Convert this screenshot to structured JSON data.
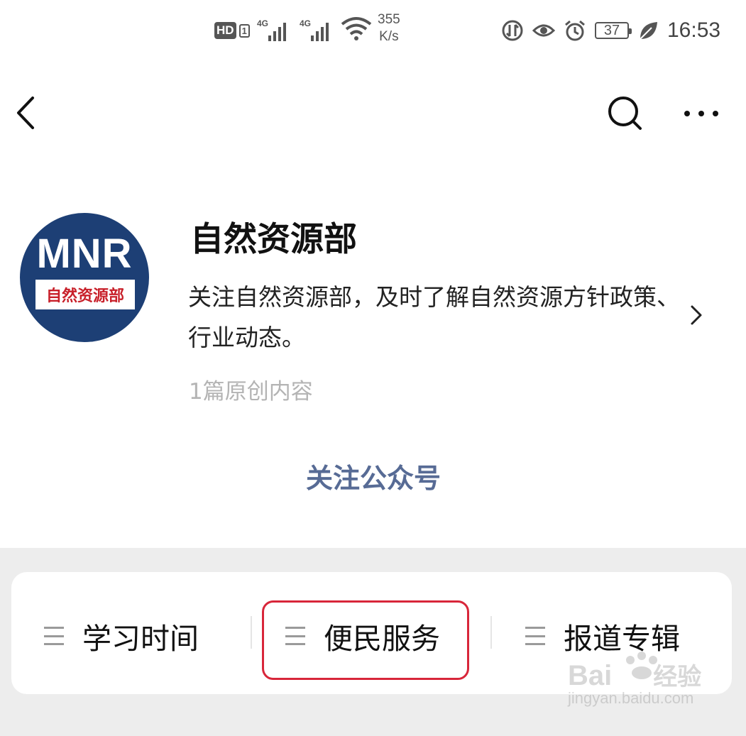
{
  "status_bar": {
    "hd": "HD",
    "hd_sub": "1",
    "sig1": "4G",
    "sig2": "4G",
    "speed_value": "355",
    "speed_unit": "K/s",
    "battery": "37",
    "time": "16:53"
  },
  "account": {
    "avatar_line1": "MNR",
    "avatar_line2": "自然资源部",
    "name": "自然资源部",
    "description": "关注自然资源部，及时了解自然资源方针政策、行业动态。",
    "original_count": "1篇原创内容",
    "follow_label": "关注公众号"
  },
  "menu": {
    "items": [
      {
        "label": "学习时间"
      },
      {
        "label": "便民服务"
      },
      {
        "label": "报道专辑"
      }
    ]
  },
  "watermark": {
    "brand": "Bai",
    "brand_suffix": "经验",
    "url": "jingyan.baidu.com"
  },
  "colors": {
    "follow": "#576b95",
    "avatar_bg": "#1d3f75",
    "highlight": "#d8263a",
    "menu_bg": "#ededed"
  }
}
